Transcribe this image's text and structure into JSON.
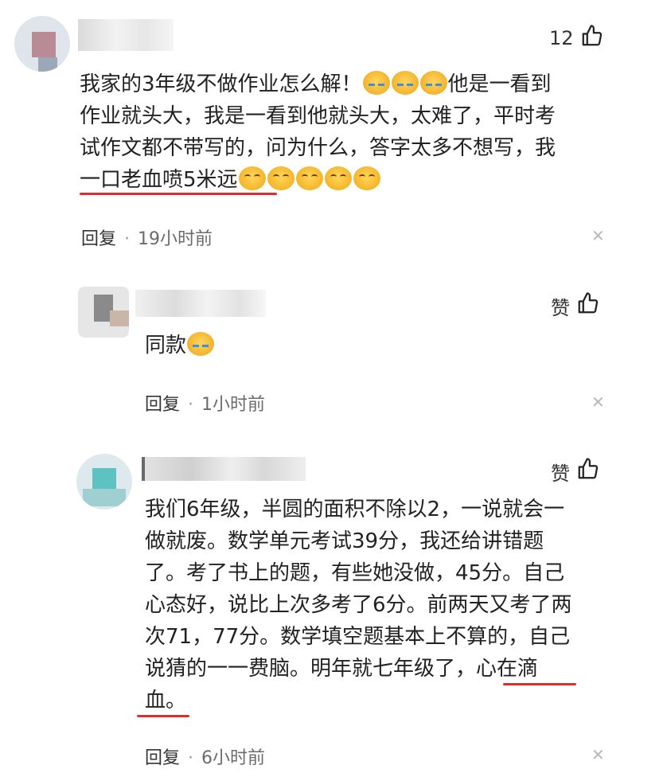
{
  "comment1": {
    "like_count": "12",
    "lines": [
      "我家的3年级不做作业怎么解！",
      "他是一看到",
      "作业就头大，我是一看到他就头大，太难了，平时考",
      "试作文都不带写的，问为什么，答字太多不想写，我",
      "一口老血喷5米远"
    ],
    "reply_label": "回复",
    "dot": "·",
    "time": "19小时前"
  },
  "reply1": {
    "like_label": "赞",
    "text": "同款",
    "reply_label": "回复",
    "dot": "·",
    "time": "1小时前"
  },
  "reply2": {
    "like_label": "赞",
    "lines": [
      "我们6年级，半圆的面积不除以2，一说就会一",
      "做就废。数学单元考试39分，我还给讲错题",
      "了。考了书上的题，有些她没做，45分。自己",
      "心态好，说比上次多考了6分。前两天又考了两",
      "次71，77分。数学填空题基本上不算的，自己",
      "说猜的一一费脑。明年就七年级了，心在滴",
      "血。"
    ],
    "reply_label": "回复",
    "dot": "·",
    "time": "6小时前"
  },
  "icons": {
    "like": "thumbs-up-icon",
    "close": "close-icon",
    "emoji_cry": "loudly-crying-emoji",
    "emoji_laugh": "tears-of-joy-emoji"
  },
  "colors": {
    "highlight_underline": "#e52a2a",
    "meta_text": "#6b6b6b"
  }
}
